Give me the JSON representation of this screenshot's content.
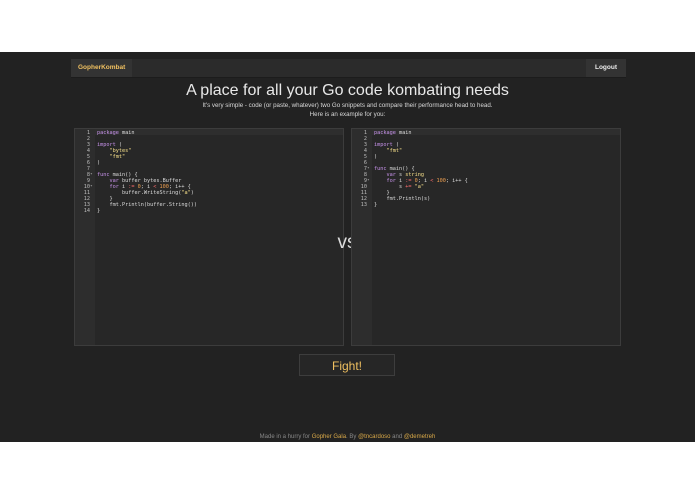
{
  "navbar": {
    "brand": "GopherKombat",
    "logout": "Logout"
  },
  "header": {
    "title": "A place for all your Go code kombating needs",
    "subtitle": "It's very simple - code (or paste, whatever) two Go snippets and compare their performance head to head.",
    "subtitle2": "Here is an example for you:"
  },
  "vs_label": "vs",
  "fight_label": "Fight!",
  "footer": {
    "prefix": "Made in a hurry for ",
    "event": "Gopher Gala",
    "mid": ". By ",
    "author1": "@tncardoso",
    "and": " and ",
    "author2": "@demetreh"
  },
  "editors": [
    {
      "lines": [
        {
          "n": "1",
          "fold": "",
          "code": [
            {
              "t": "package",
              "c": "kw"
            },
            {
              "t": " main"
            }
          ]
        },
        {
          "n": "2",
          "fold": "",
          "code": []
        },
        {
          "n": "3",
          "fold": "",
          "code": [
            {
              "t": "import",
              "c": "kw"
            },
            {
              "t": " ("
            }
          ]
        },
        {
          "n": "4",
          "fold": "",
          "code": [
            {
              "t": "    "
            },
            {
              "t": "\"bytes\"",
              "c": "str"
            }
          ]
        },
        {
          "n": "5",
          "fold": "",
          "code": [
            {
              "t": "    "
            },
            {
              "t": "\"fmt\"",
              "c": "str"
            }
          ]
        },
        {
          "n": "6",
          "fold": "",
          "code": [
            {
              "t": ")"
            }
          ]
        },
        {
          "n": "7",
          "fold": "",
          "code": []
        },
        {
          "n": "8",
          "fold": "▾",
          "code": [
            {
              "t": "func",
              "c": "kw"
            },
            {
              "t": " main() {"
            }
          ]
        },
        {
          "n": "9",
          "fold": "",
          "code": [
            {
              "t": "    "
            },
            {
              "t": "var",
              "c": "kw"
            },
            {
              "t": " buffer bytes.Buffer"
            }
          ]
        },
        {
          "n": "10",
          "fold": "▾",
          "code": [
            {
              "t": "    "
            },
            {
              "t": "for",
              "c": "kw"
            },
            {
              "t": " i "
            },
            {
              "t": ":=",
              "c": "op"
            },
            {
              "t": " "
            },
            {
              "t": "0",
              "c": "num"
            },
            {
              "t": "; i "
            },
            {
              "t": "<",
              "c": "op"
            },
            {
              "t": " "
            },
            {
              "t": "100",
              "c": "num"
            },
            {
              "t": "; i++ {"
            }
          ]
        },
        {
          "n": "11",
          "fold": "",
          "code": [
            {
              "t": "        buffer.WriteString("
            },
            {
              "t": "\"a\"",
              "c": "str"
            },
            {
              "t": ")"
            }
          ]
        },
        {
          "n": "12",
          "fold": "",
          "code": [
            {
              "t": "    }"
            }
          ]
        },
        {
          "n": "13",
          "fold": "",
          "code": [
            {
              "t": "    fmt.Println(buffer.String())"
            }
          ]
        },
        {
          "n": "14",
          "fold": "",
          "code": [
            {
              "t": "}"
            }
          ]
        }
      ]
    },
    {
      "lines": [
        {
          "n": "1",
          "fold": "",
          "code": [
            {
              "t": "package",
              "c": "kw"
            },
            {
              "t": " main"
            }
          ]
        },
        {
          "n": "2",
          "fold": "",
          "code": []
        },
        {
          "n": "3",
          "fold": "",
          "code": [
            {
              "t": "import",
              "c": "kw"
            },
            {
              "t": " ("
            }
          ]
        },
        {
          "n": "4",
          "fold": "",
          "code": [
            {
              "t": "    "
            },
            {
              "t": "\"fmt\"",
              "c": "str"
            }
          ]
        },
        {
          "n": "5",
          "fold": "",
          "code": [
            {
              "t": ")"
            }
          ]
        },
        {
          "n": "6",
          "fold": "",
          "code": []
        },
        {
          "n": "7",
          "fold": "▾",
          "code": [
            {
              "t": "func",
              "c": "kw"
            },
            {
              "t": " main() {"
            }
          ]
        },
        {
          "n": "8",
          "fold": "",
          "code": [
            {
              "t": "    "
            },
            {
              "t": "var",
              "c": "kw"
            },
            {
              "t": " s "
            },
            {
              "t": "string",
              "c": "str"
            }
          ]
        },
        {
          "n": "9",
          "fold": "▾",
          "code": [
            {
              "t": "    "
            },
            {
              "t": "for",
              "c": "kw"
            },
            {
              "t": " i "
            },
            {
              "t": ":=",
              "c": "op"
            },
            {
              "t": " "
            },
            {
              "t": "0",
              "c": "num"
            },
            {
              "t": "; i "
            },
            {
              "t": "<",
              "c": "op"
            },
            {
              "t": " "
            },
            {
              "t": "100",
              "c": "num"
            },
            {
              "t": "; i++ {"
            }
          ]
        },
        {
          "n": "10",
          "fold": "",
          "code": [
            {
              "t": "        s "
            },
            {
              "t": "+=",
              "c": "op"
            },
            {
              "t": " "
            },
            {
              "t": "\"a\"",
              "c": "str"
            }
          ]
        },
        {
          "n": "11",
          "fold": "",
          "code": [
            {
              "t": "    }"
            }
          ]
        },
        {
          "n": "12",
          "fold": "",
          "code": [
            {
              "t": "    fmt.Println(s)"
            }
          ]
        },
        {
          "n": "13",
          "fold": "",
          "code": [
            {
              "t": "}"
            }
          ]
        }
      ]
    }
  ]
}
